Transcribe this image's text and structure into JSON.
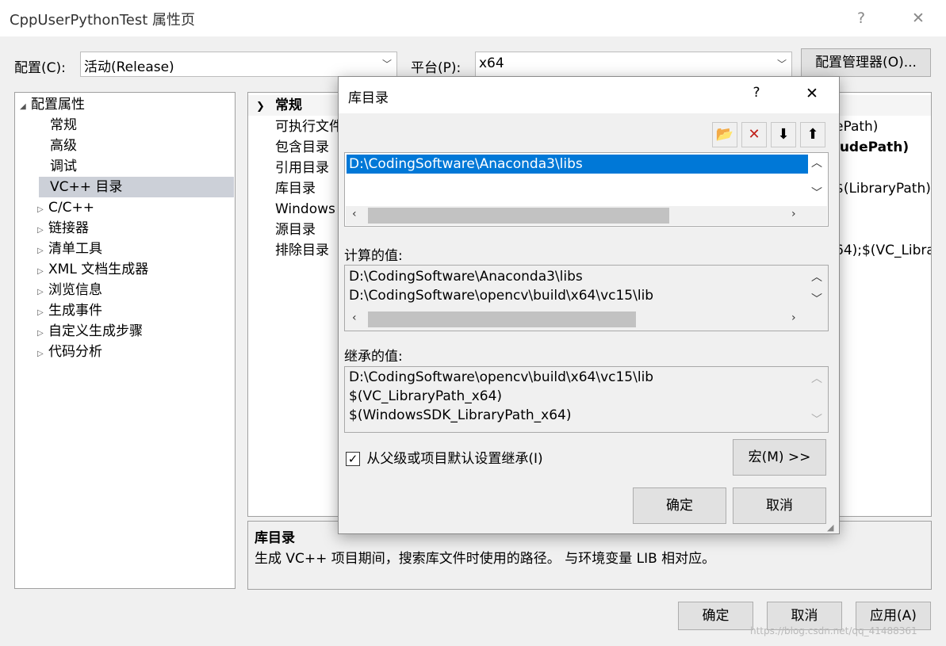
{
  "window": {
    "title": "CppUserPythonTest 属性页",
    "help_glyph": "?",
    "close_glyph": "✕"
  },
  "toolbar": {
    "config_label": "配置(C):",
    "config_value": "活动(Release)",
    "platform_label": "平台(P):",
    "platform_value": "x64",
    "config_manager_button": "配置管理器(O)..."
  },
  "tree": {
    "root": "配置属性",
    "items": [
      {
        "label": "常规",
        "expandable": false
      },
      {
        "label": "高级",
        "expandable": false
      },
      {
        "label": "调试",
        "expandable": false
      },
      {
        "label": "VC++ 目录",
        "expandable": false,
        "selected": true
      },
      {
        "label": "C/C++",
        "expandable": true
      },
      {
        "label": "链接器",
        "expandable": true
      },
      {
        "label": "清单工具",
        "expandable": true
      },
      {
        "label": "XML 文档生成器",
        "expandable": true
      },
      {
        "label": "浏览信息",
        "expandable": true
      },
      {
        "label": "生成事件",
        "expandable": true
      },
      {
        "label": "自定义生成步骤",
        "expandable": true
      },
      {
        "label": "代码分析",
        "expandable": true
      }
    ]
  },
  "grid": {
    "section": "常规",
    "rows": [
      {
        "name": "可执行文件",
        "value": "ePath)"
      },
      {
        "name": "包含目录",
        "value": "ludePath)"
      },
      {
        "name": "引用目录",
        "value": ""
      },
      {
        "name": "库目录",
        "value": "$(LibraryPath)"
      },
      {
        "name": "Windows",
        "value": ""
      },
      {
        "name": "源目录",
        "value": ""
      },
      {
        "name": "排除目录",
        "value": "64);$(VC_Libra"
      }
    ]
  },
  "description": {
    "title": "库目录",
    "text": "生成 VC++ 项目期间，搜索库文件时使用的路径。 与环境变量 LIB 相对应。"
  },
  "footer": {
    "ok": "确定",
    "cancel": "取消",
    "apply": "应用(A)"
  },
  "watermark": "https://blog.csdn.net/qq_41488361",
  "dialog": {
    "title": "库目录",
    "help_glyph": "?",
    "close_glyph": "✕",
    "entries": [
      "D:\\CodingSoftware\\Anaconda3\\libs"
    ],
    "computed_label": "计算的值:",
    "computed_values": [
      "D:\\CodingSoftware\\Anaconda3\\libs",
      "D:\\CodingSoftware\\opencv\\build\\x64\\vc15\\lib"
    ],
    "inherited_label": "继承的值:",
    "inherited_values": [
      "D:\\CodingSoftware\\opencv\\build\\x64\\vc15\\lib",
      "$(VC_LibraryPath_x64)",
      "$(WindowsSDK_LibraryPath_x64)"
    ],
    "inherit_checkbox_label": "从父级或项目默认设置继承(I)",
    "inherit_checked": true,
    "macros_button": "宏(M) >>",
    "ok": "确定",
    "cancel": "取消"
  },
  "icons": {
    "new_line": "folder-new-icon",
    "delete": "delete-icon",
    "move_down": "arrow-down-icon",
    "move_up": "arrow-up-icon"
  },
  "colors": {
    "selection": "#0078d7",
    "tree_selection": "#ccd0d8"
  }
}
